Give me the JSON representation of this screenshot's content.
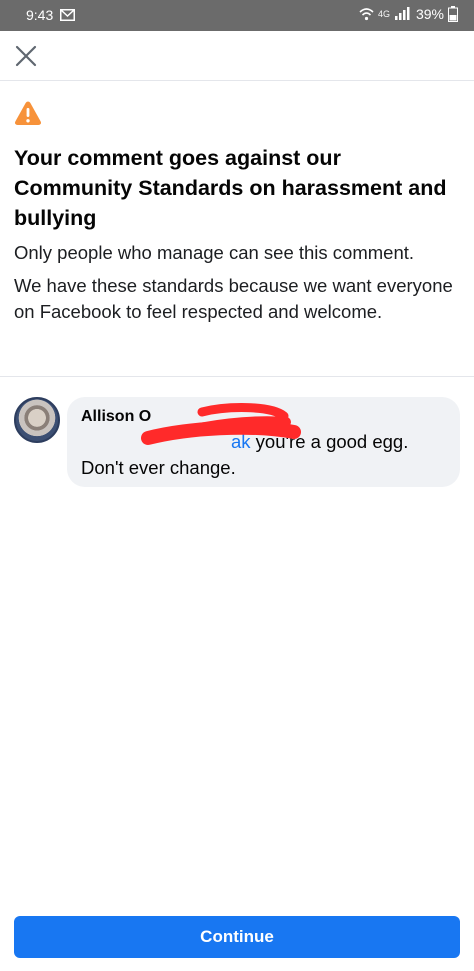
{
  "status_bar": {
    "time": "9:43",
    "network": "4G",
    "battery": "39%",
    "icons": [
      "mail-icon",
      "wifi-icon",
      "signal-icon",
      "battery-icon"
    ]
  },
  "header": {
    "close_icon": "close-icon"
  },
  "notice": {
    "icon": "warning-icon",
    "icon_color": "#f7923a",
    "title": "Your comment goes against our Community Standards on harassment and bullying",
    "visibility_text": "Only people who manage  can see this comment.",
    "reason_text": "We have these standards because we want everyone on Facebook to feel respected and welcome."
  },
  "comment": {
    "author": "Allison O",
    "mention": "ak",
    "text": " you're a good egg. Don't ever change.",
    "redaction_color": "#ff2a2a"
  },
  "footer": {
    "continue_label": "Continue",
    "button_color": "#1877f2"
  }
}
